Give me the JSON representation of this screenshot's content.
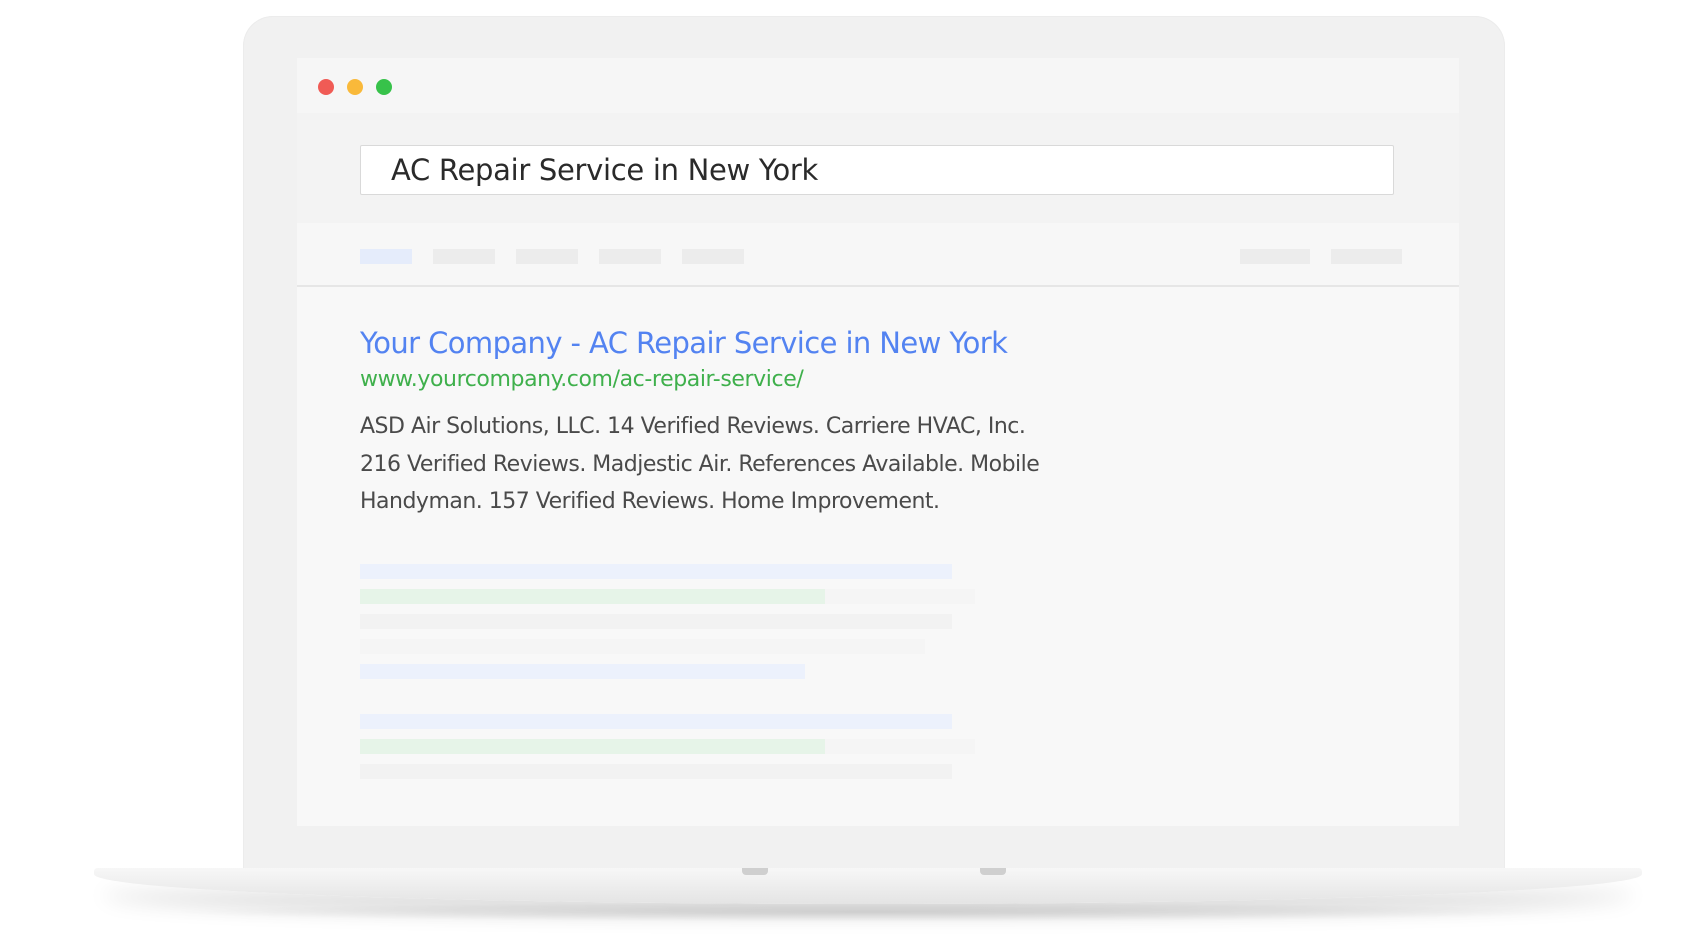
{
  "browser": {
    "window_controls": [
      {
        "name": "close",
        "color": "#f05b55"
      },
      {
        "name": "minimize",
        "color": "#f9b93a"
      },
      {
        "name": "maximize",
        "color": "#37c24a"
      }
    ]
  },
  "search": {
    "query": "AC Repair Service in New York"
  },
  "result": {
    "title": "Your Company - AC Repair Service in New York",
    "url": "www.yourcompany.com/ac-repair-service/",
    "snippet_lines": [
      "ASD Air Solutions, LLC. 14 Verified Reviews. Carriere HVAC, Inc.",
      "216 Verified Reviews. Madjestic Air. References Available. Mobile",
      "Handyman. 157 Verified Reviews. Home Improvement."
    ]
  },
  "colors": {
    "link": "#5383f1",
    "url": "#3fb04c",
    "snippet": "#4a4a4a"
  }
}
